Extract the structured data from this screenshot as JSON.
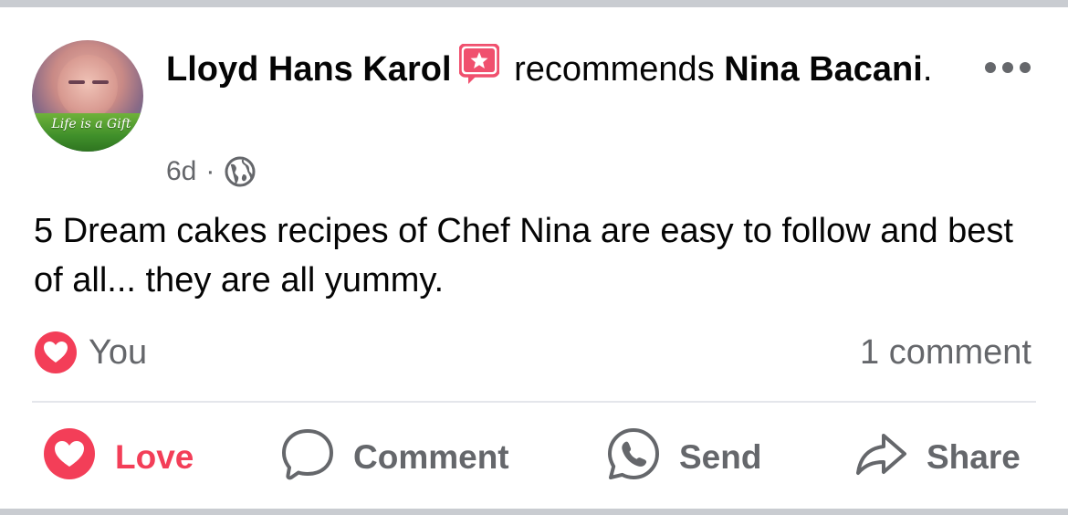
{
  "post": {
    "author": "Lloyd Hans Karol",
    "action_text": "recommends",
    "target_line1": "Nina",
    "target_line2": "Bacani",
    "target_suffix": ".",
    "time": "6d",
    "separator": "·",
    "privacy_icon": "globe-icon",
    "avatar_text": "Life is a Gift",
    "body": "5 Dream cakes recipes of Chef Nina are easy to follow and best of all... they are all yummy."
  },
  "reactions": {
    "icon": "heart-icon",
    "who": "You",
    "comment_count": "1 comment"
  },
  "actions": {
    "love": "Love",
    "comment": "Comment",
    "send": "Send",
    "share": "Share"
  },
  "colors": {
    "love": "#f33e58",
    "muted": "#65676b",
    "badge": "#f0506e",
    "divider": "#e4e6eb"
  }
}
